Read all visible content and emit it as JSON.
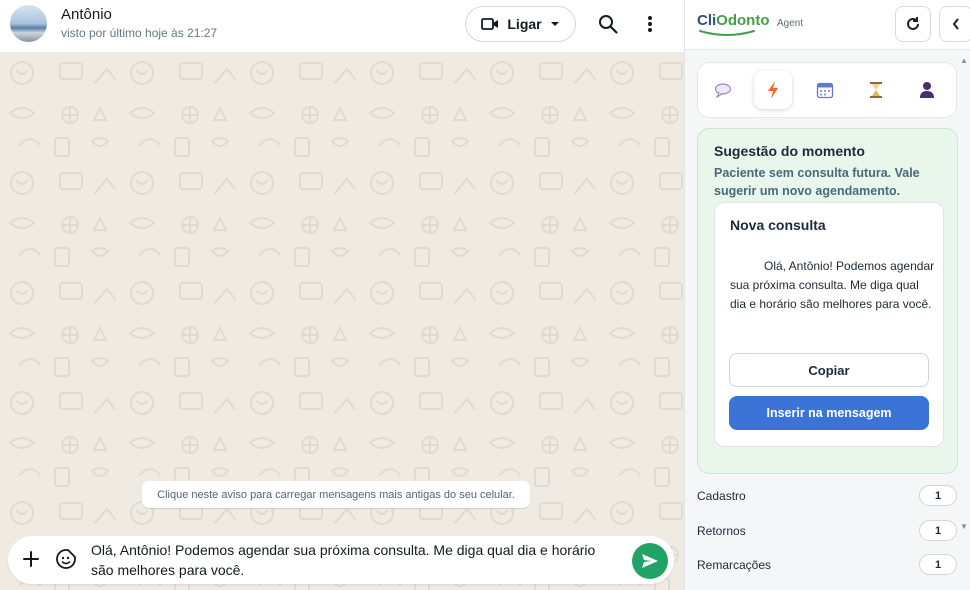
{
  "chat": {
    "contact_name": "Antônio",
    "contact_status": "visto por último hoje às 21:27",
    "call_label": "Ligar",
    "load_notice": "Clique neste aviso para carregar mensagens mais antigas do seu celular.",
    "composer_text": "Olá, Antônio! Podemos agendar sua próxima consulta. Me diga qual dia e horário são melhores para você."
  },
  "panel": {
    "brand_primary": "Cli",
    "brand_secondary": "Odonto",
    "agent_label": "Agent",
    "tabs": [
      "chat-bubble-icon",
      "lightning-icon",
      "calendar-icon",
      "hourglass-icon",
      "person-icon"
    ],
    "active_tab": "lightning-icon",
    "suggestion": {
      "title": "Sugestão do momento",
      "subtitle": "Paciente sem consulta futura. Vale sugerir um novo agendamento.",
      "card_title": "Nova consulta",
      "card_body": "Olá, Antônio! Podemos agendar sua próxima consulta. Me diga qual dia e horário são melhores para você.",
      "copy_label": "Copiar",
      "insert_label": "Inserir na mensagem"
    },
    "stats": [
      {
        "label": "Cadastro",
        "count": "1"
      },
      {
        "label": "Retornos",
        "count": "1"
      },
      {
        "label": "Remarcações",
        "count": "1"
      }
    ]
  },
  "colors": {
    "chat_background": "#efeae2",
    "send_button": "#21a366",
    "insert_button": "#3b73d6",
    "suggestion_background": "#e8f6ec",
    "brand_blue": "#2b4f8a",
    "brand_green": "#43a047"
  }
}
